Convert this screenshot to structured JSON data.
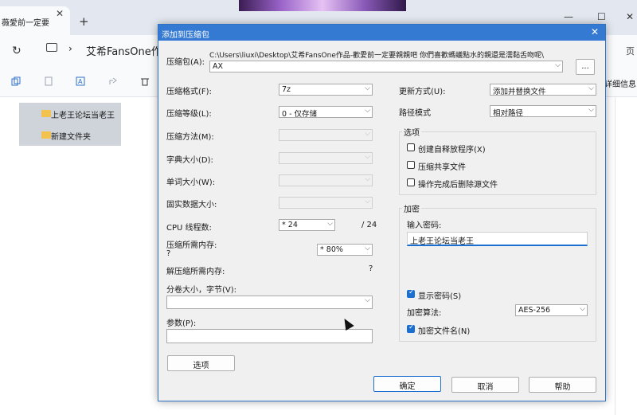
{
  "background": {
    "tab_title": "薇愛前一定要",
    "new_tab": "+",
    "address_path": "艾希FansOne作品",
    "right_crumb": "页",
    "detail_label": "详细信息",
    "folders": [
      "上老王论坛当老王",
      "新建文件夹"
    ]
  },
  "dialog": {
    "title": "添加到压缩包",
    "archive_label": "压缩包(A):",
    "archive_path": "C:\\Users\\liuxi\\Desktop\\艾希FansOne作品-歡愛前一定要親親吧 你們喜歡螞蟻點水的親還是濡黏舌吻呢\\",
    "archive_name": "AX",
    "browse_btn": "...",
    "format_label": "压缩格式(F):",
    "format_value": "7z",
    "level_label": "压缩等级(L):",
    "level_value": "0 - 仅存储",
    "method_label": "压缩方法(M):",
    "dict_label": "字典大小(D):",
    "word_label": "单词大小(W):",
    "solid_label": "固实数据大小:",
    "cpu_label": "CPU 线程数:",
    "cpu_value": "* 24",
    "cpu_total": "/ 24",
    "mem_label": "压缩所需内存:",
    "mem_q": "?",
    "mem_value": "* 80%",
    "decomp_label": "解压缩所需内存:",
    "decomp_q": "?",
    "split_label": "分卷大小，字节(V):",
    "params_label": "参数(P):",
    "options_btn": "选项",
    "update_label": "更新方式(U):",
    "update_value": "添加并替换文件",
    "pathmode_label": "路径模式",
    "pathmode_value": "相对路径",
    "options_group": "选项",
    "opt_sfx": "创建自释放程序(X)",
    "opt_shared": "压缩共享文件",
    "opt_delete": "操作完成后删除源文件",
    "encrypt_group": "加密",
    "pwd_label": "输入密码:",
    "pwd_value": "上老王论坛当老王",
    "show_pwd": "显示密码(S)",
    "enc_method_label": "加密算法:",
    "enc_method_value": "AES-256",
    "enc_names": "加密文件名(N)",
    "ok_btn": "确定",
    "cancel_btn": "取消",
    "help_btn": "帮助"
  }
}
